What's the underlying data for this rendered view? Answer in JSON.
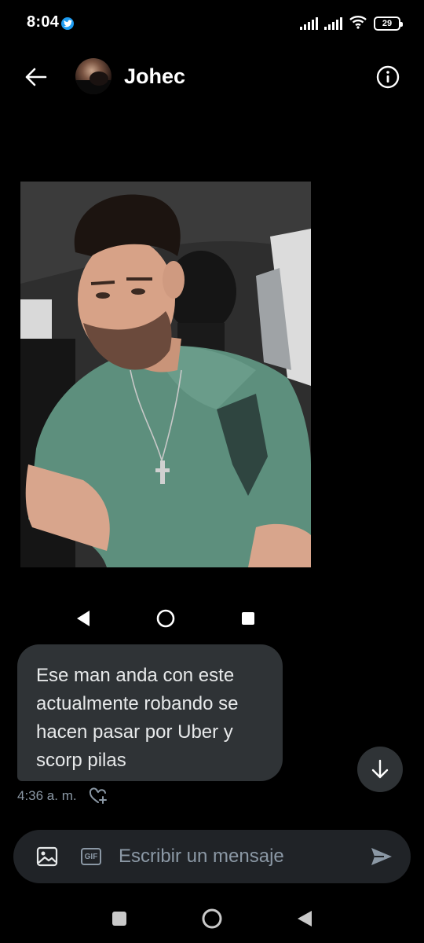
{
  "status": {
    "time": "8:04",
    "battery": "29"
  },
  "header": {
    "contact_name": "Johec"
  },
  "message": {
    "text": "Ese man anda con este actualmente robando se hacen pasar por Uber y scorp pilas",
    "time": "4:36 a. m."
  },
  "composer": {
    "placeholder": "Escribir un mensaje"
  },
  "colors": {
    "background": "#000000",
    "bubble": "#2f3336",
    "composer": "#202327",
    "muted_text": "#8b98a5",
    "accent": "#1d9bf0"
  },
  "icons": {
    "back": "arrow-left-icon",
    "info": "info-icon",
    "image": "image-icon",
    "gif": "gif-icon",
    "send": "send-icon",
    "scroll_down": "arrow-down-icon",
    "react": "heart-plus-icon"
  }
}
